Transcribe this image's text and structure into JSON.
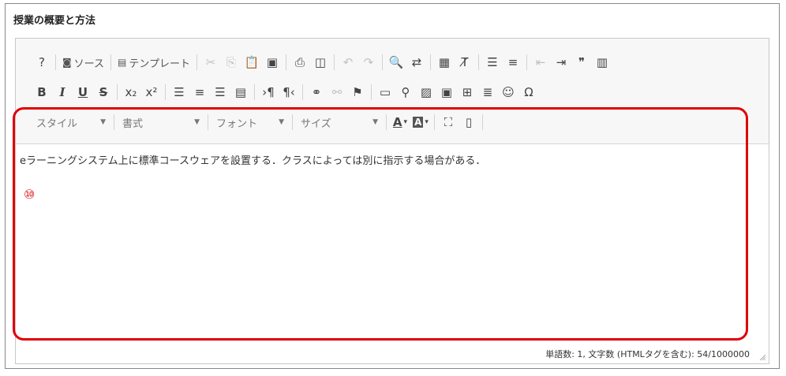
{
  "section": {
    "title": "授業の概要と方法"
  },
  "toolbar": {
    "row1": [
      {
        "name": "help-button",
        "label": "?",
        "dis": false
      },
      {
        "sep": true
      },
      {
        "name": "source-button",
        "label": "ソース",
        "icon": "◙",
        "dis": false,
        "text": true
      },
      {
        "sep": true
      },
      {
        "name": "template-button",
        "label": "テンプレート",
        "icon": "▤",
        "dis": false,
        "text": true
      },
      {
        "sep": true
      },
      {
        "name": "cut-icon",
        "label": "✂",
        "dis": true
      },
      {
        "name": "copy-icon",
        "label": "⎘",
        "dis": true
      },
      {
        "name": "paste-icon",
        "label": "📋",
        "dis": false
      },
      {
        "name": "paste-text-icon",
        "label": "▣",
        "dis": false
      },
      {
        "sep": true
      },
      {
        "name": "print-icon",
        "label": "⎙",
        "dis": false
      },
      {
        "name": "preview-icon",
        "label": "◫",
        "dis": false
      },
      {
        "sep": true
      },
      {
        "name": "undo-icon",
        "label": "↶",
        "dis": true
      },
      {
        "name": "redo-icon",
        "label": "↷",
        "dis": true
      },
      {
        "sep": true
      },
      {
        "name": "find-icon",
        "label": "🔍",
        "dis": false
      },
      {
        "name": "replace-icon",
        "label": "⇄",
        "dis": false
      },
      {
        "sep": true
      },
      {
        "name": "select-all-icon",
        "label": "▦",
        "dis": false
      },
      {
        "name": "remove-format-icon",
        "label": "T̸",
        "dis": false
      },
      {
        "sep": true
      },
      {
        "name": "numbered-list-icon",
        "label": "☰",
        "dis": false
      },
      {
        "name": "bullet-list-icon",
        "label": "≡",
        "dis": false
      },
      {
        "sep": true
      },
      {
        "name": "outdent-icon",
        "label": "⇤",
        "dis": true
      },
      {
        "name": "indent-icon",
        "label": "⇥",
        "dis": false
      },
      {
        "name": "blockquote-icon",
        "label": "❞",
        "dis": false
      },
      {
        "name": "div-icon",
        "label": "▥",
        "dis": false
      }
    ],
    "row2": [
      {
        "name": "bold-button",
        "label": "B",
        "cls": "b"
      },
      {
        "name": "italic-button",
        "label": "I",
        "cls": "i"
      },
      {
        "name": "underline-button",
        "label": "U",
        "cls": "u"
      },
      {
        "name": "strike-button",
        "label": "S",
        "cls": "s"
      },
      {
        "sep": true
      },
      {
        "name": "subscript-icon",
        "label": "x₂"
      },
      {
        "name": "superscript-icon",
        "label": "x²"
      },
      {
        "sep": true
      },
      {
        "name": "align-left-icon",
        "label": "☰"
      },
      {
        "name": "align-center-icon",
        "label": "≡"
      },
      {
        "name": "align-right-icon",
        "label": "☰"
      },
      {
        "name": "justify-icon",
        "label": "▤"
      },
      {
        "sep": true
      },
      {
        "name": "ltr-icon",
        "label": "›¶"
      },
      {
        "name": "rtl-icon",
        "label": "¶‹"
      },
      {
        "sep": true
      },
      {
        "name": "link-icon",
        "label": "⚭"
      },
      {
        "name": "unlink-icon",
        "label": "⚯",
        "dis": true
      },
      {
        "name": "anchor-icon",
        "label": "⚑"
      },
      {
        "sep": true
      },
      {
        "name": "insert-icon",
        "label": "▭"
      },
      {
        "name": "pin-icon",
        "label": "⚲"
      },
      {
        "name": "image-icon",
        "label": "▨"
      },
      {
        "name": "video-icon",
        "label": "▣"
      },
      {
        "name": "table-icon",
        "label": "⊞"
      },
      {
        "name": "hr-icon",
        "label": "≣"
      },
      {
        "name": "smiley-icon",
        "label": "☺"
      },
      {
        "name": "special-char-icon",
        "label": "Ω"
      }
    ],
    "row3": {
      "style_label": "スタイル",
      "format_label": "書式",
      "font_label": "フォント",
      "size_label": "サイズ",
      "text_color_label": "A",
      "bg_color_label": "A",
      "maximize_label": "⛶",
      "blocks_label": "▯"
    }
  },
  "content": {
    "text": "eラーニングシステム上に標準コースウェアを設置する．クラスによっては別に指示する場合がある．",
    "marker": "⑩"
  },
  "status": {
    "text": "単語数: 1, 文字数 (HTMLタグを含む): 54/1000000"
  }
}
